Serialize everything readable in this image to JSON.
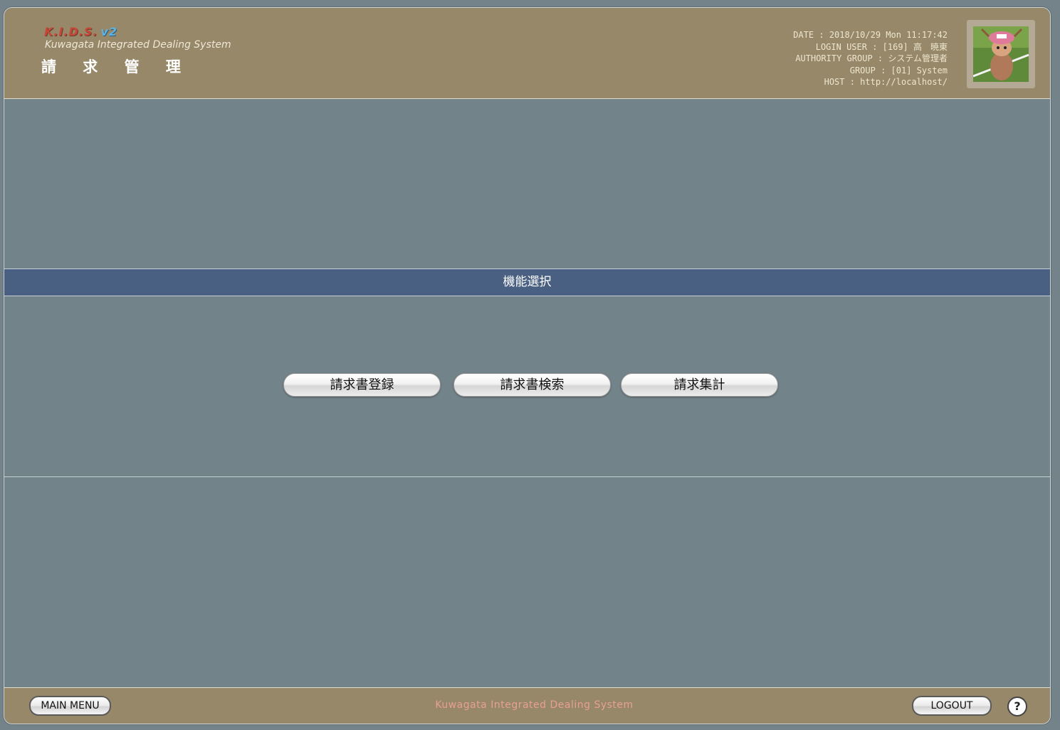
{
  "header": {
    "logo": "K.I.D.S.",
    "logo_version": "v2",
    "logo_subtitle": "Kuwagata Integrated Dealing System",
    "page_title": "請 求 管 理",
    "info": {
      "date": "DATE : 2018/10/29 Mon 11:17:42",
      "login_user": "LOGIN USER : [169] 高　暁東",
      "authority_group": "AUTHORITY GROUP : システム管理者",
      "group": "GROUP : [01] System",
      "host": "HOST : http://localhost/"
    },
    "avatar": "avatar-image"
  },
  "main": {
    "section_title": "機能選択",
    "buttons": [
      "請求書登録",
      "請求書検索",
      "請求集計"
    ]
  },
  "footer": {
    "main_menu_label": "MAIN MENU",
    "center_text": "Kuwagata Integrated Dealing System",
    "logout_label": "LOGOUT",
    "help_label": "?"
  },
  "colors": {
    "header_bg": "#968868",
    "body_bg": "#73838a",
    "band_bg": "#4a6083",
    "footer_text": "#e8a090"
  }
}
